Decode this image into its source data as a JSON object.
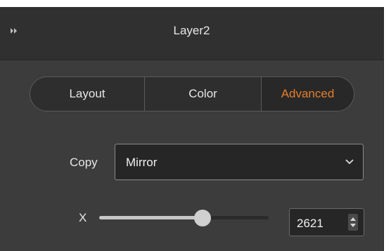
{
  "panel": {
    "title": "Layer2",
    "collapse_icon": "double-chevron-right-icon"
  },
  "tabs": [
    {
      "label": "Layout",
      "active": false
    },
    {
      "label": "Color",
      "active": false
    },
    {
      "label": "Advanced",
      "active": true
    }
  ],
  "copy": {
    "label": "Copy",
    "selected": "Mirror",
    "icon": "chevron-down-icon"
  },
  "x": {
    "label": "X",
    "slider_fraction": 0.61,
    "value": "2621",
    "icon": "spinner-arrows-icon"
  },
  "colors": {
    "accent": "#e57e2b",
    "panel_bg": "#3c3c3c",
    "header_bg": "#303030"
  }
}
